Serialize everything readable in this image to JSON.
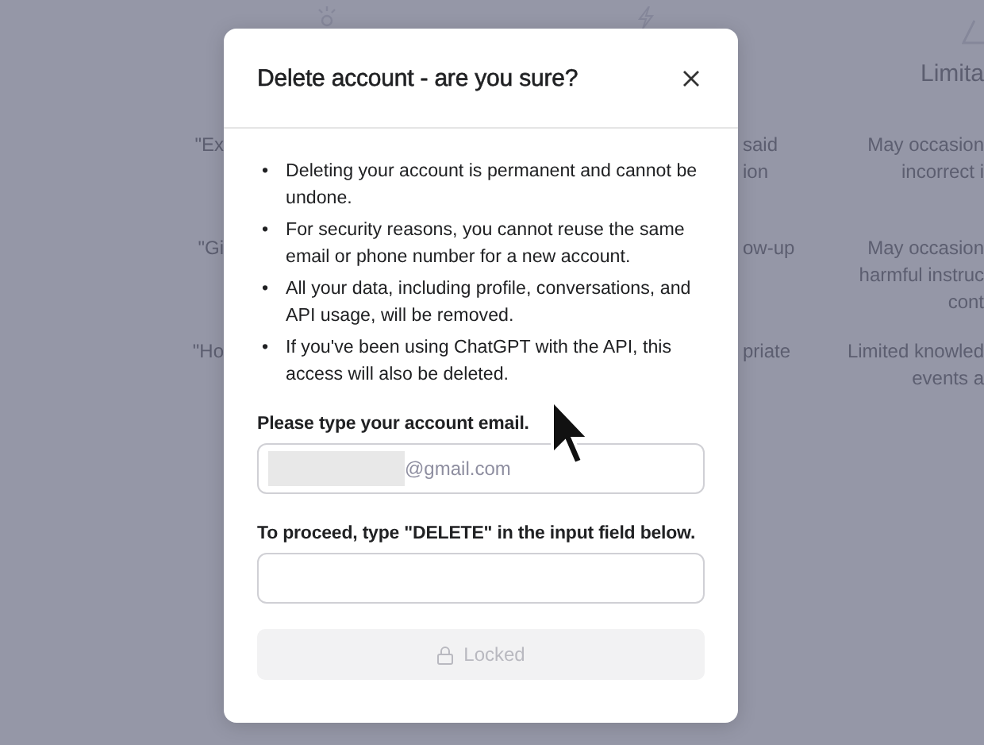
{
  "background": {
    "left_cards": [
      {
        "lines": [
          "\"Ex"
        ]
      },
      {
        "lines": [
          "\"Gi"
        ]
      },
      {
        "lines": [
          "\"Ho"
        ]
      }
    ],
    "middle_fragments": [
      {
        "lines": [
          "said",
          "ion"
        ]
      },
      {
        "lines": [
          "ow-up"
        ]
      },
      {
        "lines": [
          "priate"
        ]
      }
    ],
    "right_column": {
      "title": "Limita",
      "cards": [
        {
          "lines": [
            "May occasion",
            "incorrect i"
          ]
        },
        {
          "lines": [
            "May occasion",
            "harmful instruc",
            "cont"
          ]
        },
        {
          "lines": [
            "Limited knowled",
            "events a"
          ]
        }
      ]
    }
  },
  "dialog": {
    "title": "Delete account - are you sure?",
    "bullet_marker": "•",
    "bullets": [
      "Deleting your account is permanent and cannot be undone.",
      "For security reasons, you cannot reuse the same email or phone number for a new account.",
      "All your data, including profile, conversations, and API usage, will be removed.",
      "If you've been using ChatGPT with the API, this access will also be deleted."
    ],
    "email": {
      "label": "Please type your account email.",
      "value": "@gmail.com",
      "redacted": true
    },
    "confirm": {
      "label": "To proceed, type \"DELETE\" in the input field below."
    },
    "button": {
      "label": "Locked",
      "disabled": true
    }
  }
}
